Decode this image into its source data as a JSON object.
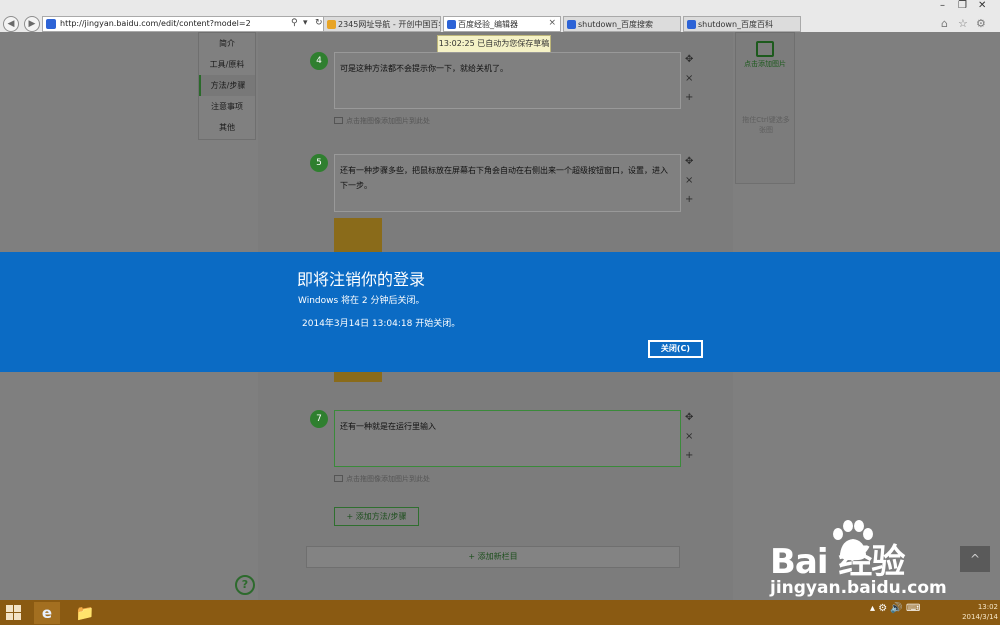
{
  "browser": {
    "url": "http://jingyan.baidu.com/edit/content?model=2",
    "tabs": [
      {
        "label": "2345网址导航 - 开创中国百年..."
      },
      {
        "label": "百度经验_编辑器",
        "active": true
      },
      {
        "label": "shutdown_百度搜索"
      },
      {
        "label": "shutdown_百度百科"
      }
    ]
  },
  "autosave_tip": "13:02:25 已自动为您保存草稿",
  "side_menu": [
    "简介",
    "工具/原料",
    "方法/步骤",
    "注意事项",
    "其他"
  ],
  "side_menu_active": "方法/步骤",
  "right_panel": {
    "add_image": "点击添加图片",
    "drag_hint": "拖住Ctrl键选多张图"
  },
  "steps": [
    {
      "num": "4",
      "text": "可是这种方法都不会提示你一下，就给关机了。",
      "hint": "点击拖图像添加图片到此处"
    },
    {
      "num": "5",
      "text": "还有一种步骤多些，把鼠标放在屏幕右下角会自动在右侧出来一个超级按钮窗口，设置，进入下一步。",
      "hint": ""
    },
    {
      "num": "7",
      "text": "还有一种就是在运行里输入",
      "hint": "点击拖图像添加图片到此处"
    }
  ],
  "add_step_label": "+ 添加方法/步骤",
  "add_section_label": "+ 添加新栏目",
  "help_icon": "?",
  "scroll_top_icon": "^",
  "watermark": {
    "brand": "Bai 经验",
    "url": "jingyan.baidu.com"
  },
  "dialog": {
    "title": "即将注销你的登录",
    "message": "Windows 将在 2 分钟后关闭。",
    "time_message": "2014年3月14日 13:04:18 开始关闭。",
    "close_label": "关闭(C)"
  },
  "taskbar": {
    "time": "13:02",
    "date": "2014/3/14"
  },
  "colors": {
    "dialog_blue": "#0b6bc4",
    "taskbar": "#8a5a12",
    "accent_green": "#2f7f2f"
  }
}
